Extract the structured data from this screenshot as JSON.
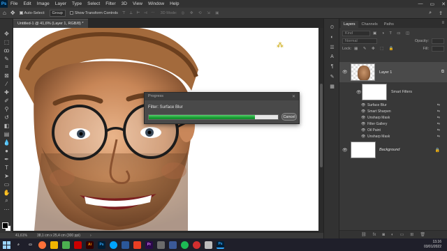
{
  "app": {
    "logo": "Ps"
  },
  "menu": [
    "File",
    "Edit",
    "Image",
    "Layer",
    "Type",
    "Select",
    "Filter",
    "3D",
    "View",
    "Window",
    "Help"
  ],
  "window_controls": {
    "minimize": "—",
    "restore": "▭",
    "close": "✕"
  },
  "options_bar": {
    "auto_select_label": "Auto-Select:",
    "auto_select_value": "Group",
    "show_transform_label": "Show Transform Controls",
    "mode_3d_label": "3D Mode:"
  },
  "document_tab": "Untitled-1 @ 41,6% (Layer 1, RGB/8) *",
  "status_bar": {
    "zoom": "41,61%",
    "doc_size": "38,1 cm x 25,4 cm (300 ppi)"
  },
  "progress_dialog": {
    "title": "Progress",
    "close": "✕",
    "label": "Filter: Surface Blur",
    "progress": 0.82,
    "cancel_label": "Cancel"
  },
  "layers_panel": {
    "tabs": [
      "Layers",
      "Channels",
      "Paths"
    ],
    "kind_placeholder": "Kind",
    "blend_mode": "Normal",
    "opacity_label": "Opacity:",
    "lock_label": "Lock:",
    "fill_label": "Fill:",
    "layer1_name": "Layer 1",
    "smart_filters_label": "Smart Filters",
    "filters": [
      "Surface Blur",
      "Smart Sharpen",
      "Unsharp Mask",
      "Filter Gallery",
      "Oil Paint",
      "Unsharp Mask"
    ],
    "background_name": "Background"
  },
  "taskbar": {
    "time": "13.16",
    "date": "03/01/2022"
  },
  "colors": {
    "progress_fill": "#1fa53a",
    "ps_blue": "#31a8ff",
    "panel_bg": "#383838"
  }
}
